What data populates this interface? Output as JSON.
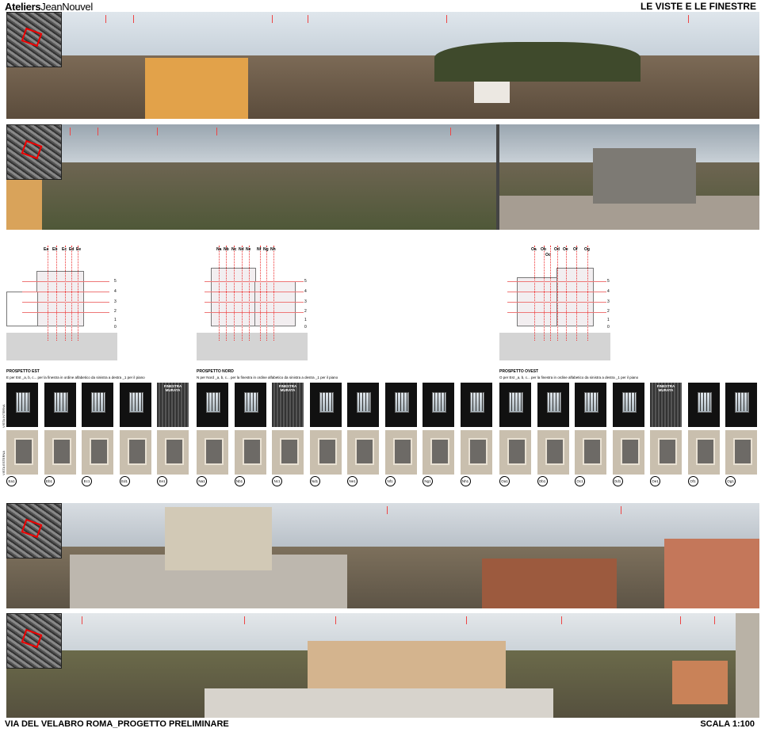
{
  "header": {
    "brand_bold": "Ateliers",
    "brand_light": "JeanNouvel",
    "title": "LE VISTE E LE FINESTRE"
  },
  "footer": {
    "project": "VIA DEL VELABRO ROMA_PROGETTO PRELIMINARE",
    "scale": "SCALA 1:100"
  },
  "colors": {
    "accent_red": "#e03030",
    "sky": "#c9d3dc",
    "city": "#7a6a55"
  },
  "panoramas": [
    {
      "name": "view-1",
      "tags": [
        "",
        "",
        "",
        "",
        "",
        "",
        ""
      ]
    },
    {
      "name": "view-2",
      "tags": [
        "",
        "",
        "",
        "",
        ""
      ]
    },
    {
      "name": "view-3",
      "tags": [
        "",
        ""
      ]
    },
    {
      "name": "view-4",
      "tags": [
        "",
        "",
        "",
        "",
        "",
        "",
        ""
      ]
    }
  ],
  "elevations": {
    "east": {
      "labels": [
        "Ea",
        "Eb",
        "Ec",
        "Ed",
        "Ee"
      ],
      "levels": [
        "5",
        "4",
        "3",
        "2",
        "1",
        "0"
      ]
    },
    "north": {
      "labels": [
        "Na",
        "Nb",
        "Nc",
        "Nd",
        "Ne",
        "Nf",
        "Ng",
        "Nh"
      ],
      "levels": [
        "5",
        "4",
        "3",
        "2",
        "1",
        "0"
      ]
    },
    "west": {
      "labels": [
        "Oa",
        "Ob",
        "Oc",
        "Od",
        "Oe",
        "Of",
        "Og"
      ],
      "levels": [
        "5",
        "4",
        "3",
        "2",
        "1",
        "0"
      ]
    }
  },
  "sections": {
    "east": {
      "title": "PROSPETTO EST",
      "desc": "E per Est _a, b, c... per la finestra in ordine alfabetico da sinistra a destra _1 per il piano"
    },
    "north": {
      "title": "PROSPETTO NORD",
      "desc": "N per Nord _a, b, c... per la finestra in ordine alfabetico da sinistra a destra _1 per il piano"
    },
    "west": {
      "title": "PROSPETTO OVEST",
      "desc": "O per Est _a, b, c... per la finestra in ordine alfabetico da sinistra a destra _1 per il piano"
    }
  },
  "side_labels": {
    "interior": "VISTA INTERNA",
    "exterior": "VISTA ESTERNA"
  },
  "walled_label": "FINESTRA MURATA",
  "window_codes": [
    "Ea1",
    "Eb1",
    "Ec1",
    "Ed1",
    "Ee1",
    "Na1",
    "Nb1",
    "Nc1",
    "Nd1",
    "Ne1",
    "Nf1",
    "Ng1",
    "Nh1",
    "Oa1",
    "Ob1",
    "Oc1",
    "Od1",
    "Oe1",
    "Of1",
    "Og1"
  ],
  "window_interior_types": [
    "win",
    "win",
    "win",
    "win",
    "walled",
    "win",
    "win",
    "walled",
    "win",
    "win",
    "win",
    "win",
    "win",
    "win",
    "win",
    "win",
    "win",
    "walled",
    "win",
    "win"
  ]
}
